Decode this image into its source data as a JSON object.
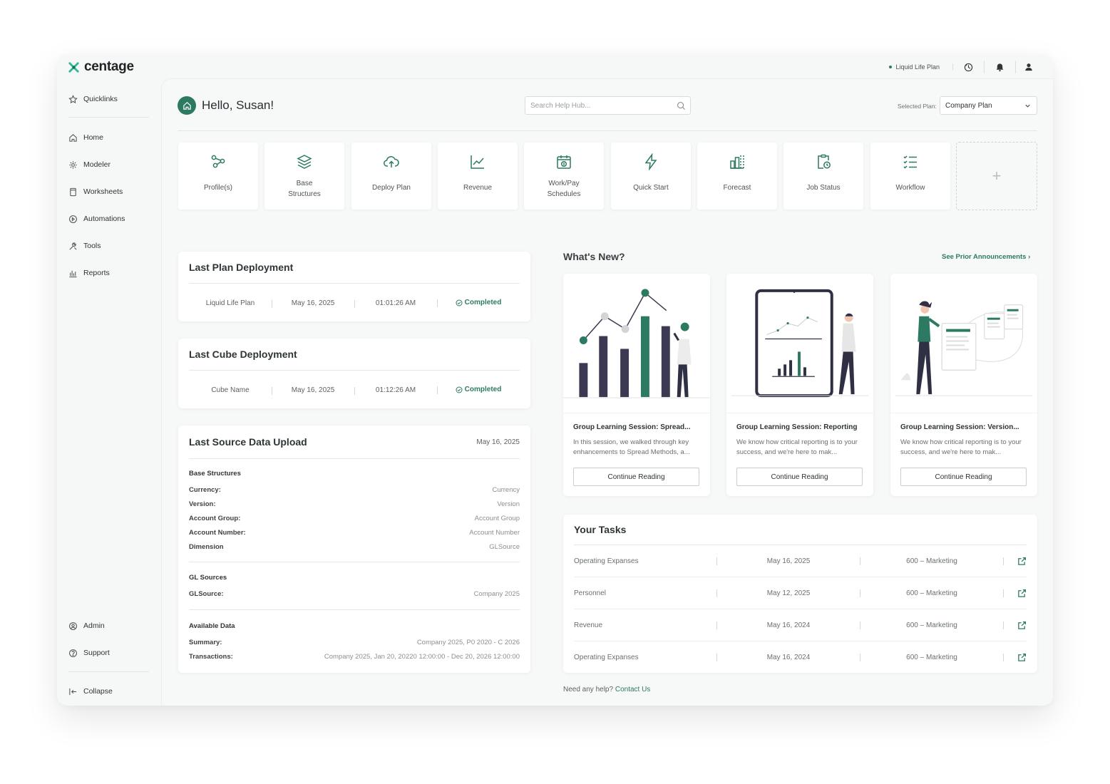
{
  "brand": {
    "name": "centage",
    "accent": "#2c7a62"
  },
  "topbar": {
    "plan_status": "Liquid Life Plan"
  },
  "sidebar": {
    "items": [
      {
        "label": "Quicklinks",
        "icon": "star-icon"
      },
      {
        "label": "Home",
        "icon": "home-icon"
      },
      {
        "label": "Modeler",
        "icon": "cube-icon"
      },
      {
        "label": "Worksheets",
        "icon": "worksheet-icon"
      },
      {
        "label": "Automations",
        "icon": "automation-icon"
      },
      {
        "label": "Tools",
        "icon": "tools-icon"
      },
      {
        "label": "Reports",
        "icon": "reports-icon"
      }
    ],
    "bottom": [
      {
        "label": "Admin",
        "icon": "admin-icon"
      },
      {
        "label": "Support",
        "icon": "help-icon"
      },
      {
        "label": "Collapse",
        "icon": "collapse-icon"
      }
    ]
  },
  "header": {
    "greeting": "Hello, Susan!",
    "search_placeholder": "Search Help Hub...",
    "selected_plan_label": "Selected Plan:",
    "selected_plan_value": "Company Plan"
  },
  "quick_tiles": [
    {
      "label": "Profile(s)",
      "icon": "profiles-icon"
    },
    {
      "label": "Base\nStructures",
      "icon": "layers-icon"
    },
    {
      "label": "Deploy Plan",
      "icon": "cloud-upload-icon"
    },
    {
      "label": "Revenue",
      "icon": "line-chart-icon"
    },
    {
      "label": "Work/Pay\nSchedules",
      "icon": "calendar-dollar-icon"
    },
    {
      "label": "Quick Start",
      "icon": "bolt-icon"
    },
    {
      "label": "Forecast",
      "icon": "forecast-icon"
    },
    {
      "label": "Job Status",
      "icon": "clipboard-clock-icon"
    },
    {
      "label": "Workflow",
      "icon": "checklist-icon"
    }
  ],
  "add_tile": "+",
  "last_plan": {
    "title": "Last Plan Deployment",
    "name": "Liquid Life Plan",
    "date": "May 16, 2025",
    "time": "01:01:26 AM",
    "status": "Completed"
  },
  "last_cube": {
    "title": "Last Cube Deployment",
    "name": "Cube Name",
    "date": "May 16, 2025",
    "time": "01:12:26 AM",
    "status": "Completed"
  },
  "last_upload": {
    "title": "Last Source Data Upload",
    "date": "May 16, 2025",
    "base_structures": {
      "heading": "Base Structures",
      "rows": [
        {
          "k": "Currency:",
          "v": "Currency"
        },
        {
          "k": "Version:",
          "v": "Version"
        },
        {
          "k": "Account Group:",
          "v": "Account Group"
        },
        {
          "k": "Account Number:",
          "v": "Account Number"
        },
        {
          "k": "Dimension",
          "v": "GLSource"
        }
      ]
    },
    "gl_sources": {
      "heading": "GL Sources",
      "rows": [
        {
          "k": "GLSource:",
          "v": "Company 2025"
        }
      ]
    },
    "available": {
      "heading": "Available Data",
      "rows": [
        {
          "k": "Summary:",
          "v": "Company 2025, P0 2020 - C 2026"
        },
        {
          "k": "Transactions:",
          "v": "Company 2025, Jan 20, 20220 12:00:00 - Dec 20, 2026 12:00:00"
        }
      ]
    }
  },
  "whats_new": {
    "title": "What's New?",
    "link": "See Prior Announcements",
    "cards": [
      {
        "title": "Group Learning Session: Spread...",
        "desc": "In this session, we walked through key enhancements to Spread Methods, a...",
        "button": "Continue Reading"
      },
      {
        "title": "Group Learning Session: Reporting",
        "desc": "We know how critical reporting is to your success, and we're here to mak...",
        "button": "Continue Reading"
      },
      {
        "title": "Group Learning Session: Version...",
        "desc": "We know how critical reporting is to your success, and we're here to mak...",
        "button": "Continue Reading"
      }
    ]
  },
  "tasks": {
    "title": "Your Tasks",
    "rows": [
      {
        "name": "Operating Expanses",
        "date": "May 16, 2025",
        "category": "600 – Marketing"
      },
      {
        "name": "Personnel",
        "date": "May 12, 2025",
        "category": "600 – Marketing"
      },
      {
        "name": "Revenue",
        "date": "May 16, 2024",
        "category": "600 – Marketing"
      },
      {
        "name": "Operating Expanses",
        "date": "May 16, 2024",
        "category": "600 – Marketing"
      }
    ]
  },
  "help": {
    "text": "Need any help?",
    "link": "Contact Us"
  }
}
